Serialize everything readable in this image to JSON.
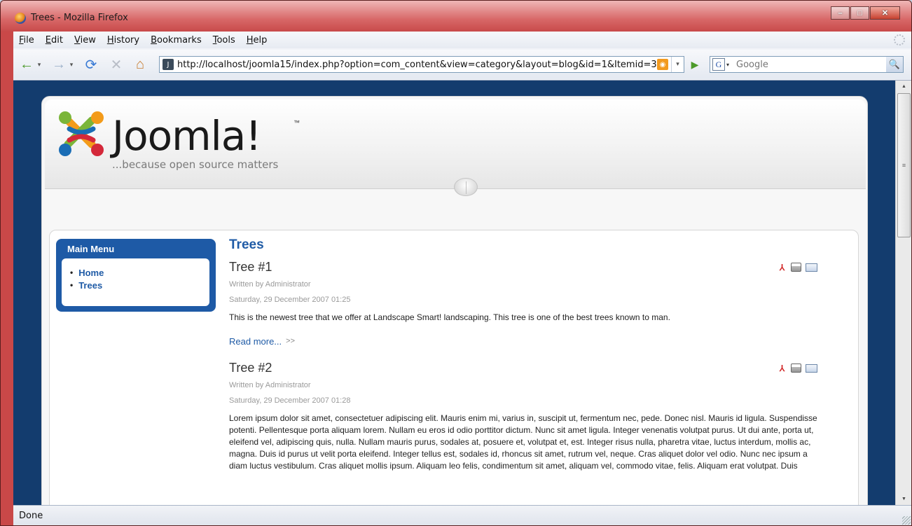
{
  "window": {
    "title": "Trees - Mozilla Firefox",
    "controls": {
      "minimize": "–",
      "maximize": "□",
      "close": "✕"
    }
  },
  "menubar": {
    "items": [
      "File",
      "Edit",
      "View",
      "History",
      "Bookmarks",
      "Tools",
      "Help"
    ]
  },
  "navbar": {
    "url": "http://localhost/joomla15/index.php?option=com_content&view=category&layout=blog&id=1&Itemid=3",
    "search_placeholder": "Google",
    "icons": {
      "back": "←",
      "forward": "→",
      "reload": "⟳",
      "stop": "✕",
      "home": "⌂",
      "go": "▶",
      "search": "🔍",
      "dropdown": "▾"
    }
  },
  "site": {
    "logo_text": "Joomla!",
    "logo_tm": "™",
    "tagline": "...because open source matters"
  },
  "mainmenu": {
    "title": "Main Menu",
    "items": [
      "Home",
      "Trees"
    ]
  },
  "category_title": "Trees",
  "articles": [
    {
      "title": "Tree #1",
      "author": "Written by Administrator",
      "date": "Saturday, 29 December 2007 01:25",
      "text": "This is the newest tree that we offer at Landscape Smart! landscaping. This tree is one of the best trees known to man.",
      "readmore": "Read more...",
      "readmore_arrows": ">>"
    },
    {
      "title": "Tree #2",
      "author": "Written by Administrator",
      "date": "Saturday, 29 December 2007 01:28",
      "text": "Lorem ipsum dolor sit amet, consectetuer adipiscing elit. Mauris enim mi, varius in, suscipit ut, fermentum nec, pede. Donec nisl. Mauris id ligula. Suspendisse potenti. Pellentesque porta aliquam lorem. Nullam eu eros id odio porttitor dictum. Nunc sit amet ligula. Integer venenatis volutpat purus. Ut dui ante, porta ut, eleifend vel, adipiscing quis, nulla. Nullam mauris purus, sodales at, posuere et, volutpat et, est. Integer risus nulla, pharetra vitae, luctus interdum, mollis ac, magna. Duis id purus ut velit porta eleifend. Integer tellus est, sodales id, rhoncus sit amet, rutrum vel, neque. Cras aliquet dolor vel odio. Nunc nec ipsum a diam luctus vestibulum. Cras aliquet mollis ipsum. Aliquam leo felis, condimentum sit amet, aliquam vel, commodo vitae, felis. Aliquam erat volutpat. Duis"
    }
  ],
  "statusbar": {
    "text": "Done"
  }
}
